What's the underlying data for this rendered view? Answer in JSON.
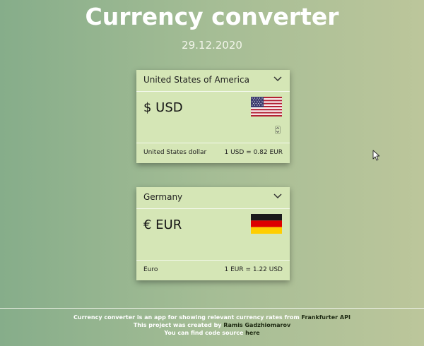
{
  "header": {
    "title": "Currency converter",
    "date": "29.12.2020"
  },
  "cards": [
    {
      "country": "United States of America",
      "code_display": "$ USD",
      "flag_icon": "us-flag-icon",
      "currency_name": "United States dollar",
      "rate": "1 USD = 0.82 EUR"
    },
    {
      "country": "Germany",
      "code_display": "€ EUR",
      "flag_icon": "germany-flag-icon",
      "currency_name": "Euro",
      "rate": "1 EUR = 1.22 USD"
    }
  ],
  "footer": {
    "line1_text": "Currency converter is an app for showing relevant currency rates from ",
    "line1_link": "Frankfurter API",
    "line2_text": "This project was created by ",
    "line2_link": "Ramis Gadzhiomarov",
    "line3_text": "You can find code source ",
    "line3_link": "here"
  },
  "colors": {
    "background_left": "#86ad8a",
    "background_right": "#bcc69b",
    "card": "#d5e6b6",
    "title": "#ffffff",
    "footer_link": "#1e2a12"
  }
}
